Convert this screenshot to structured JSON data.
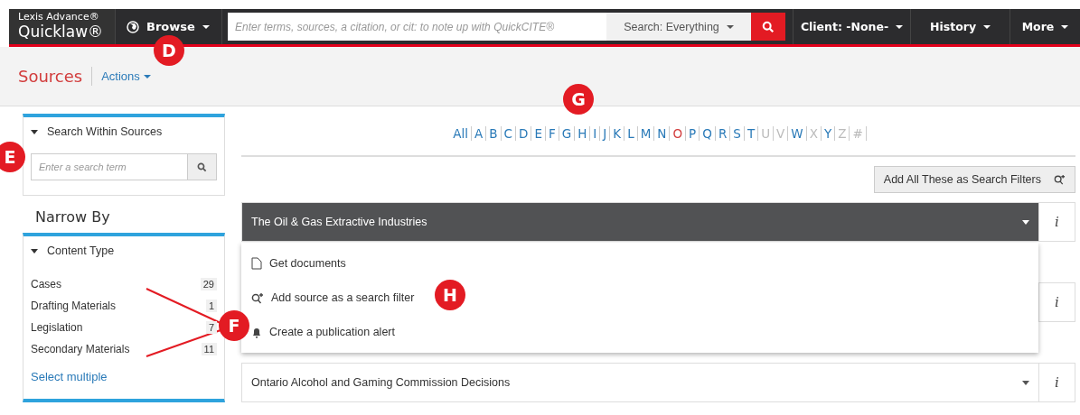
{
  "header": {
    "brand_top": "Lexis Advance®",
    "brand_bottom": "Quicklaw®",
    "browse": "Browse",
    "search_placeholder": "Enter terms, sources, a citation, or cit: to note up with QuickCITE®",
    "search_scope": "Search: Everything",
    "menus": [
      "Client: -None-",
      "History",
      "More"
    ]
  },
  "page": {
    "title": "Sources",
    "actions": "Actions"
  },
  "sidebar": {
    "search_title": "Search Within Sources",
    "search_placeholder": "Enter a search term",
    "narrow_title": "Narrow By",
    "facet_title": "Content Type",
    "facets": [
      {
        "label": "Cases",
        "count": "29"
      },
      {
        "label": "Drafting Materials",
        "count": "1"
      },
      {
        "label": "Legislation",
        "count": "7"
      },
      {
        "label": "Secondary Materials",
        "count": "11"
      }
    ],
    "select_multiple": "Select multiple"
  },
  "alphabet": [
    {
      "label": "All",
      "selected": false,
      "disabled": false
    },
    {
      "label": "A",
      "selected": false,
      "disabled": false
    },
    {
      "label": "B",
      "selected": false,
      "disabled": false
    },
    {
      "label": "C",
      "selected": false,
      "disabled": false
    },
    {
      "label": "D",
      "selected": false,
      "disabled": false
    },
    {
      "label": "E",
      "selected": false,
      "disabled": false
    },
    {
      "label": "F",
      "selected": false,
      "disabled": false
    },
    {
      "label": "G",
      "selected": false,
      "disabled": false
    },
    {
      "label": "H",
      "selected": false,
      "disabled": false
    },
    {
      "label": "I",
      "selected": false,
      "disabled": false
    },
    {
      "label": "J",
      "selected": false,
      "disabled": false
    },
    {
      "label": "K",
      "selected": false,
      "disabled": false
    },
    {
      "label": "L",
      "selected": false,
      "disabled": false
    },
    {
      "label": "M",
      "selected": false,
      "disabled": false
    },
    {
      "label": "N",
      "selected": false,
      "disabled": false
    },
    {
      "label": "O",
      "selected": true,
      "disabled": false
    },
    {
      "label": "P",
      "selected": false,
      "disabled": false
    },
    {
      "label": "Q",
      "selected": false,
      "disabled": false
    },
    {
      "label": "R",
      "selected": false,
      "disabled": false
    },
    {
      "label": "S",
      "selected": false,
      "disabled": false
    },
    {
      "label": "T",
      "selected": false,
      "disabled": false
    },
    {
      "label": "U",
      "selected": false,
      "disabled": true
    },
    {
      "label": "V",
      "selected": false,
      "disabled": true
    },
    {
      "label": "W",
      "selected": false,
      "disabled": false
    },
    {
      "label": "X",
      "selected": false,
      "disabled": true
    },
    {
      "label": "Y",
      "selected": false,
      "disabled": false
    },
    {
      "label": "Z",
      "selected": false,
      "disabled": true
    },
    {
      "label": "#",
      "selected": false,
      "disabled": true
    }
  ],
  "add_all_button": "Add All These as Search Filters",
  "sources": [
    {
      "title": "The Oil & Gas Extractive Industries",
      "expanded": true,
      "info": "i"
    },
    {
      "info": "i"
    },
    {
      "title": "Ontario Alcohol and Gaming Commission Decisions",
      "expanded": false,
      "info": "i"
    }
  ],
  "dropdown": [
    {
      "kind": "document",
      "label": "Get documents"
    },
    {
      "kind": "filter",
      "label": "Add source as a search filter"
    },
    {
      "kind": "alert",
      "label": "Create a publication alert"
    }
  ],
  "callouts": [
    {
      "label": "D"
    },
    {
      "label": "E"
    },
    {
      "label": "F"
    },
    {
      "label": "G"
    },
    {
      "label": "H"
    }
  ]
}
